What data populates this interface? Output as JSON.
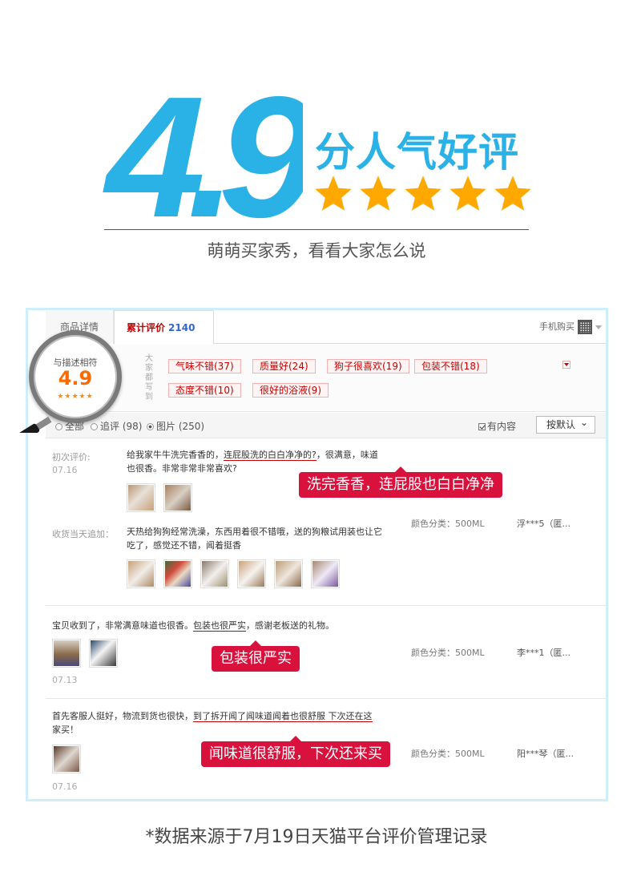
{
  "hero": {
    "score": "4.9",
    "title": "分人气好评",
    "star_count": 5,
    "subtitle": "萌萌买家秀，看看大家怎么说",
    "colors": {
      "accent_blue": "#2ab2e6",
      "star_orange": "#ffa800"
    }
  },
  "magnifier": {
    "label": "与描述相符",
    "score": "4.9",
    "stars": "★★★★★"
  },
  "tabs": {
    "detail": "商品详情",
    "reviews_label": "累计评价",
    "reviews_count": "2140",
    "mobile_buy": "手机购买"
  },
  "summary": {
    "category_label": "大家都写到",
    "tags": [
      "气味不错(37)",
      "质量好(24)",
      "狗子很喜欢(19)",
      "包装不错(18)",
      "态度不错(10)",
      "很好的浴液(9)"
    ]
  },
  "filter": {
    "all": "全部",
    "append": "追评 (98)",
    "pictures": "图片 (250)",
    "has_content": "有内容",
    "sort": "按默认"
  },
  "reviews": [
    {
      "first_label": "初次评价:",
      "first_date": "07.16",
      "text_line1_pre": "给我家牛牛洗完香香的，",
      "text_line1_highlight": "连屁股洗的白白净净的?",
      "text_line1_post": "，很满意，味道",
      "text_line2": "也很香。非常非常非常喜欢?",
      "callout": "洗完香香，连屁股也白白净净",
      "append_label": "收货当天追加：",
      "append_line1": "天热给狗狗经常洗澡，东西用着很不错哦，送的狗粮试用装也让它",
      "append_line2": "吃了，感觉还不错，闻着挺香",
      "spec": "颜色分类：500ML",
      "user": "浮***5（匿..."
    },
    {
      "text_pre": "宝贝收到了，非常满意味道也很香。",
      "text_highlight": "包装也很严实",
      "text_post": "，感谢老板送的礼物。",
      "callout": "包装很严实",
      "date": "07.13",
      "spec": "颜色分类：500ML",
      "user": "李***1（匿..."
    },
    {
      "text_pre": "首先客服人挺好，物流到货也很快，",
      "text_highlight": "到了拆开闻了闻味道闻着也很舒服 下次还在这",
      "text_line2": "家买！",
      "callout": "闻味道很舒服，下次还来买",
      "date": "07.16",
      "spec": "颜色分类：500ML",
      "user": "阳***琴（匿..."
    }
  ],
  "footnote": "*数据来源于7月19日天猫平台评价管理记录"
}
